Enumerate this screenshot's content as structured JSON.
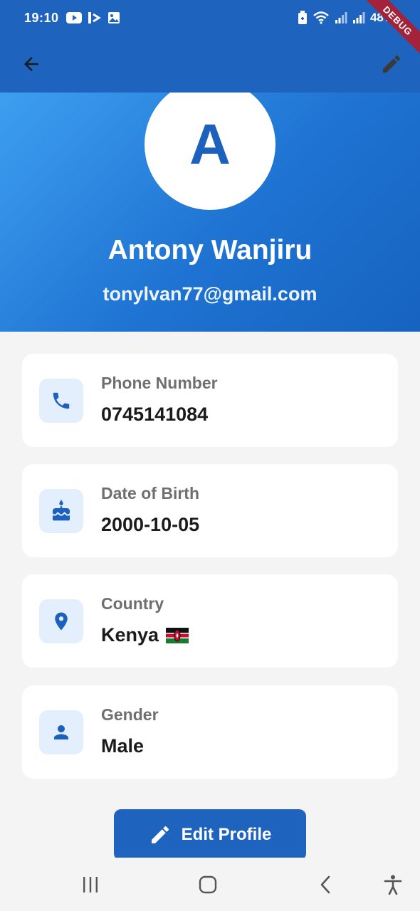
{
  "status_bar": {
    "time": "19:10",
    "battery_text": "48%",
    "icons": [
      "youtube-icon",
      "signal-app-icon",
      "gallery-icon",
      "battery-saver-icon",
      "wifi-icon",
      "signal-bars-icon",
      "signal-bars-icon"
    ]
  },
  "debug_banner": "DEBUG",
  "profile": {
    "avatar_letter": "A",
    "name": "Antony Wanjiru",
    "email": "tonylvan77@gmail.com"
  },
  "cards": [
    {
      "icon": "phone-icon",
      "label": "Phone Number",
      "value": "0745141084"
    },
    {
      "icon": "cake-icon",
      "label": "Date of Birth",
      "value": "2000-10-05"
    },
    {
      "icon": "location-pin-icon",
      "label": "Country",
      "value": "Kenya",
      "flag": "kenya-flag-icon"
    },
    {
      "icon": "person-icon",
      "label": "Gender",
      "value": "Male"
    }
  ],
  "edit_button": {
    "label": "Edit Profile"
  },
  "colors": {
    "primary": "#1e63be",
    "header_gradient_start": "#3d9ff0",
    "header_gradient_end": "#1663c0",
    "icon_box_bg": "#e3effc",
    "page_bg": "#f4f4f5"
  },
  "nav_bar": {
    "items": [
      "recent-apps-icon",
      "home-icon",
      "back-nav-icon",
      "accessibility-icon"
    ]
  }
}
